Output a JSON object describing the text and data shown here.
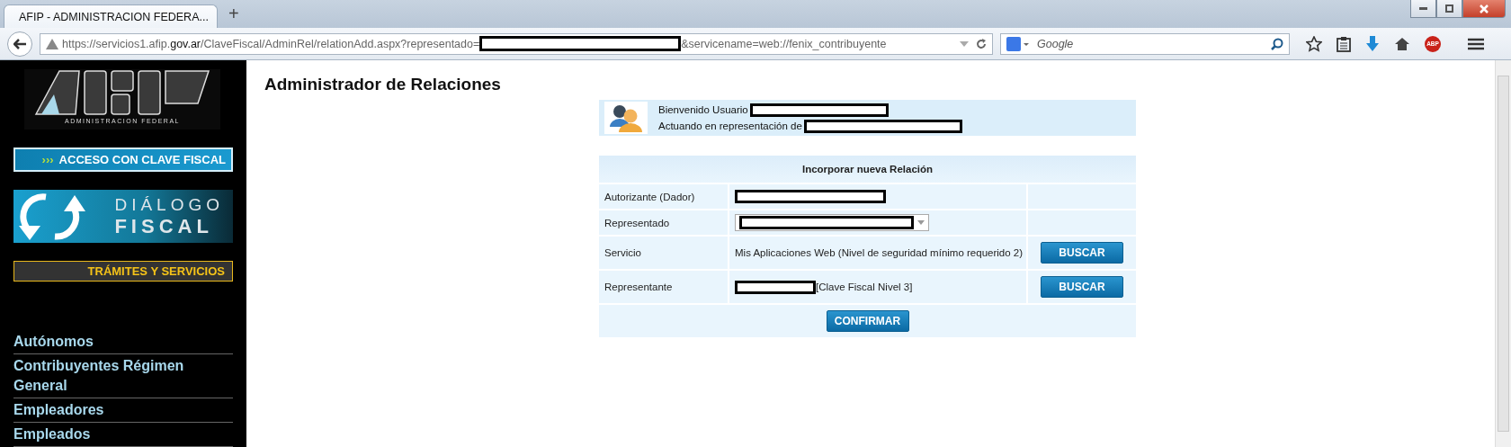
{
  "browser": {
    "tab_title": "AFIP - ADMINISTRACION FEDERA...",
    "new_tab": "+",
    "url_start": "https://servicios1.afip.",
    "url_domain": "gov.ar",
    "url_path": "/ClaveFiscal/AdminRel/relationAdd.aspx?representado=",
    "url_end": "&servicename=web://fenix_contribuyente",
    "search_placeholder": "Google",
    "addon_badge": "ABP"
  },
  "sidebar": {
    "logo_caption": "ADMINISTRACION FEDERAL",
    "access_arrows": "›››",
    "access_label": "ACCESO CON CLAVE FISCAL",
    "dialogo_top": "DIÁLOGO",
    "dialogo_bottom": "FISCAL",
    "tramites": "TRÁMITES Y SERVICIOS",
    "items": [
      {
        "label": "Autónomos"
      },
      {
        "label": "Contribuyentes Régimen General"
      },
      {
        "label": "Empleadores"
      },
      {
        "label": "Empleados"
      }
    ]
  },
  "main": {
    "title": "Administrador de Relaciones",
    "welcome": {
      "user_label": "Bienvenido Usuario",
      "acting_label": "Actuando en representación de"
    },
    "form": {
      "header": "Incorporar nueva Relación",
      "rows": [
        {
          "kind": "redacted",
          "label": "Autorizante (Dador)"
        },
        {
          "kind": "select",
          "label": "Representado"
        },
        {
          "kind": "text",
          "label": "Servicio",
          "value": "Mis Aplicaciones Web (Nivel de seguridad mínimo requerido 2)",
          "button": "BUSCAR"
        },
        {
          "kind": "redacted_text",
          "label": "Representante",
          "value": "[Clave Fiscal Nivel 3]",
          "button": "BUSCAR"
        }
      ],
      "confirm": "CONFIRMAR"
    }
  }
}
